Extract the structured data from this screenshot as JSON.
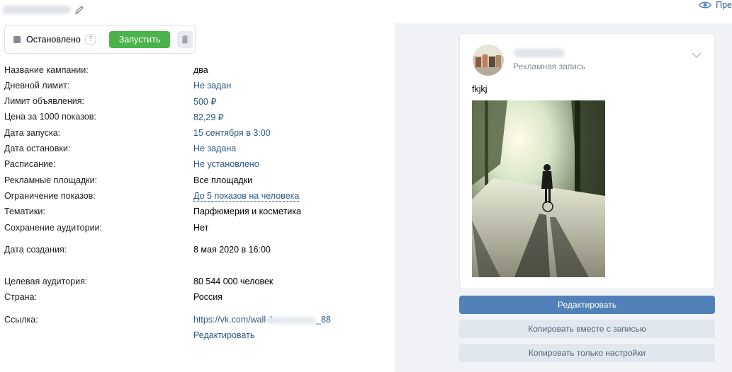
{
  "header": {
    "preview_label": "Пре"
  },
  "status": {
    "label": "Остановлено",
    "help_glyph": "?",
    "start_label": "Запустить"
  },
  "info": [
    {
      "label": "Название кампании:",
      "value": "два",
      "is_link": false
    },
    {
      "label": "Дневной лимит:",
      "value": "Не задан",
      "is_link": true
    },
    {
      "label": "Лимит объявления:",
      "value": "500 ₽",
      "is_link": true
    },
    {
      "label": "Цена за 1000 показов:",
      "value": "82,29 ₽",
      "is_link": true
    },
    {
      "label": "Дата запуска:",
      "value": "15 сентября в 3:00",
      "is_link": true
    },
    {
      "label": "Дата остановки:",
      "value": "Не задана",
      "is_link": true
    },
    {
      "label": "Расписание:",
      "value": "Не установлено",
      "is_link": true
    },
    {
      "label": "Рекламные площадки:",
      "value": "Все площадки",
      "is_link": false
    },
    {
      "label": "Ограничение показов:",
      "value": "До 5 показов на человека",
      "is_link": true
    },
    {
      "label": "Тематики:",
      "value": "Парфюмерия и косметика",
      "is_link": false
    },
    {
      "label": "Сохранение аудитории:",
      "value": "Нет",
      "is_link": false
    },
    {
      "label": "Дата создания:",
      "value": "8 мая 2020 в 16:00",
      "is_link": false
    },
    {
      "label": "Целевая аудитория:",
      "value": "80 544 000 человек",
      "is_link": false
    },
    {
      "label": "Страна:",
      "value": "Россия",
      "is_link": false
    },
    {
      "label": "Ссылка:",
      "value": "https://vk.com/wall-1",
      "is_link": true
    }
  ],
  "link_suffix": "_88",
  "edit_link_label": "Редактировать",
  "post": {
    "ad_label": "Рекламная запись",
    "text": "fkjkj"
  },
  "actions": {
    "edit": "Редактировать",
    "copy_with_post": "Копировать вместе с записью",
    "copy_settings_only": "Копировать только настройки"
  },
  "colors": {
    "link": "#2a5885",
    "start_button": "#4bb34b",
    "primary_button": "#5181b8",
    "panel_bg": "#f0f2f5"
  },
  "icons": [
    "pencil-icon",
    "eye-icon",
    "help-icon",
    "trash-icon",
    "chevron-down-icon"
  ]
}
